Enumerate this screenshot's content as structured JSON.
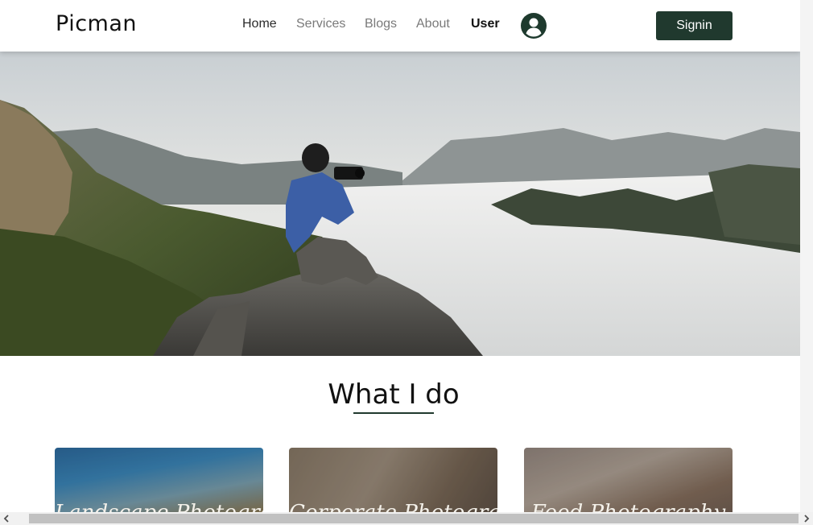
{
  "navbar": {
    "brand": "Picman",
    "links": [
      "Home",
      "Services",
      "Blogs",
      "About",
      "User"
    ],
    "signin_label": "Signin"
  },
  "hero": {
    "image": "photographer-on-mountain-rock-above-clouds"
  },
  "section": {
    "title": "What I do"
  },
  "cards": [
    {
      "title": "Landscape Photography",
      "image": "sunset-sky-landscape"
    },
    {
      "title": "Corporate Photography",
      "image": "businessman-on-phone"
    },
    {
      "title": "Food Photography",
      "image": "coffee-cups-on-table"
    }
  ],
  "colors": {
    "accent": "#20392e",
    "nav_inactive": "#7a7a7a",
    "background": "#ffffff"
  },
  "scrollbar": {
    "left_arrow": "‹",
    "right_arrow": "›"
  }
}
